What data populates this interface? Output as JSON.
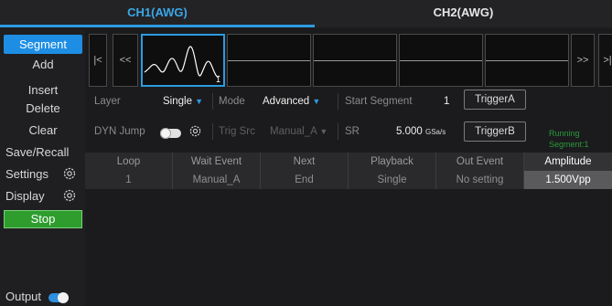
{
  "tabs": [
    {
      "label": "CH1(AWG)",
      "active": true
    },
    {
      "label": "CH2(AWG)",
      "active": false
    }
  ],
  "sidebar": {
    "items": [
      {
        "label": "Segment"
      },
      {
        "label": "Add"
      },
      {
        "label": "Insert"
      },
      {
        "label": "Delete"
      },
      {
        "label": "Clear"
      },
      {
        "label": "Save/Recall"
      },
      {
        "label": "Settings"
      },
      {
        "label": "Display"
      },
      {
        "label": "Stop"
      }
    ],
    "output_label": "Output"
  },
  "nav": {
    "first": "|<",
    "prev": "<<",
    "next": ">>",
    "last": ">|"
  },
  "segments": {
    "selected_index": "1"
  },
  "params": {
    "layer_label": "Layer",
    "layer_value": "Single",
    "mode_label": "Mode",
    "mode_value": "Advanced",
    "start_segment_label": "Start Segment",
    "start_segment_value": "1",
    "dyn_jump_label": "DYN Jump",
    "trig_src_label": "Trig Src",
    "trig_src_value": "Manual_A",
    "sr_label": "SR",
    "sr_value": "5.000",
    "sr_unit": "GSa/s",
    "trigger_a": "TriggerA",
    "trigger_b": "TriggerB",
    "running_line1": "Running",
    "running_line2": "Segment:1"
  },
  "table": {
    "headers": [
      "Loop",
      "Wait Event",
      "Next",
      "Playback",
      "Out Event",
      "Amplitude"
    ],
    "rows": [
      [
        "1",
        "Manual_A",
        "End",
        "Single",
        "No setting",
        "1.500Vpp"
      ]
    ]
  },
  "colors": {
    "accent": "#2c9be0",
    "stop": "#2e9d2e",
    "running": "#2a9a3a"
  }
}
